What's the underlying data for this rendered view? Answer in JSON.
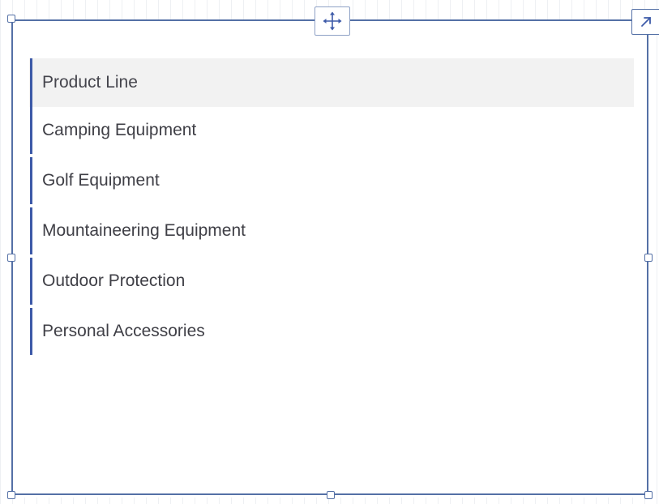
{
  "widget": {
    "header_label": "Product Line",
    "items": [
      {
        "label": "Camping Equipment"
      },
      {
        "label": "Golf Equipment"
      },
      {
        "label": "Mountaineering Equipment"
      },
      {
        "label": "Outdoor Protection"
      },
      {
        "label": "Personal Accessories"
      }
    ]
  },
  "icons": {
    "move": "move-arrows-icon",
    "expand": "expand-arrow-icon"
  },
  "colors": {
    "frame": "#5470a6",
    "accent_bar": "#3d5aa8",
    "header_background": "#f2f2f2",
    "text": "#3f3f46"
  }
}
